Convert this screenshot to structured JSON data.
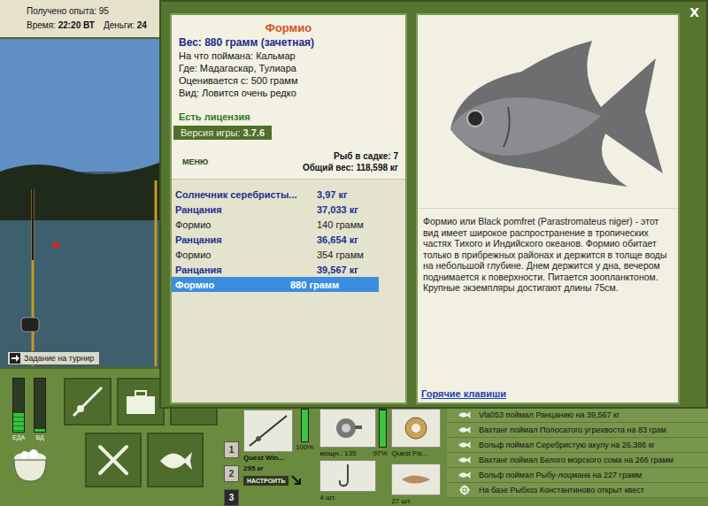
{
  "hud": {
    "experience": "Получено опыта: 95",
    "time_label": "Время:",
    "time": "22:20 ВТ",
    "money_label": "Деньги:",
    "money": "24"
  },
  "scene": {
    "task_button": "Задание на турнир"
  },
  "meters": [
    {
      "label": "ЕДА",
      "level": 0.35
    },
    {
      "label": "ВД",
      "level": 0.05
    }
  ],
  "slots": [
    {
      "label": "1",
      "selected": false
    },
    {
      "label": "2",
      "selected": false
    },
    {
      "label": "3",
      "selected": true
    }
  ],
  "tackle": {
    "rod": {
      "name": "Quest Win...",
      "weight": "295 кг",
      "button": "НАСТРОИТЬ",
      "condition": "100%",
      "level": 1
    },
    "reel": {
      "power": "мощн.: 135",
      "condition": "97%",
      "level": 0.97
    },
    "line": {
      "name": "Quest Fis..."
    },
    "hook": {
      "count": "4 шт."
    },
    "lure": {
      "count": "27 шт."
    }
  },
  "feed": [
    {
      "text": "Vla053 поймал Ранцанию на 39,567 кг",
      "kind": "catch"
    },
    {
      "text": "Вахтанг поймал Полосатого угрехвоста на 83 грам",
      "kind": "catch"
    },
    {
      "text": "Вольф поймал Серебристую акулу на 26,386 кг",
      "kind": "catch"
    },
    {
      "text": "Вахтанг поймал Белого морского сома на 266 грамм",
      "kind": "catch"
    },
    {
      "text": "Вольф поймал Рыбу-лоцмана на 227 грамм",
      "kind": "catch"
    },
    {
      "text": "На базе Рыбхоз Константиново открыт квест",
      "kind": "event"
    }
  ],
  "dialog": {
    "close": "X",
    "fish": {
      "name": "Формио",
      "weight": "Вес: 880 грамм (зачетная)",
      "details": [
        "На что поймана: Кальмар",
        "Где: Мадагаскар, Тулиара",
        "Оценивается с: 500 грамм",
        "Вид: Ловится очень редко"
      ],
      "license": "Есть лицензия",
      "version_label": "Версия игры:",
      "version": "3.7.6"
    },
    "menu_button": "МЕНЮ",
    "keepnet_count": "Рыб в садке: 7",
    "total_weight": "Общий вес: 118,598 кг",
    "catches": [
      {
        "name": "Солнечник серебристы...",
        "weight": "3,97 кг",
        "highlighted": true,
        "selected": false
      },
      {
        "name": "Ранцания",
        "weight": "37,033 кг",
        "highlighted": true,
        "selected": false
      },
      {
        "name": "Формио",
        "weight": "140 грамм",
        "highlighted": false,
        "selected": false
      },
      {
        "name": "Ранцания",
        "weight": "36,654 кг",
        "highlighted": true,
        "selected": false
      },
      {
        "name": "Формио",
        "weight": "354 грамм",
        "highlighted": false,
        "selected": false
      },
      {
        "name": "Ранцания",
        "weight": "39,567 кг",
        "highlighted": true,
        "selected": false
      },
      {
        "name": "Формио",
        "weight": "880 грамм",
        "highlighted": true,
        "selected": true
      }
    ],
    "description": "Формио или Black pomfret (Parastromateus niger) - этот вид имеет широкое распространение в тропических частях Тихого и Индийского океанов. Формио обитает только в прибрежных районах и держится в толще воды на небольшой глубине. Днем держится у дна, вечером поднимается к поверхности. Питается зоопланктоном. Крупные экземпляры достигают длины 75см.",
    "hotkeys": "Горячие клавиши"
  }
}
